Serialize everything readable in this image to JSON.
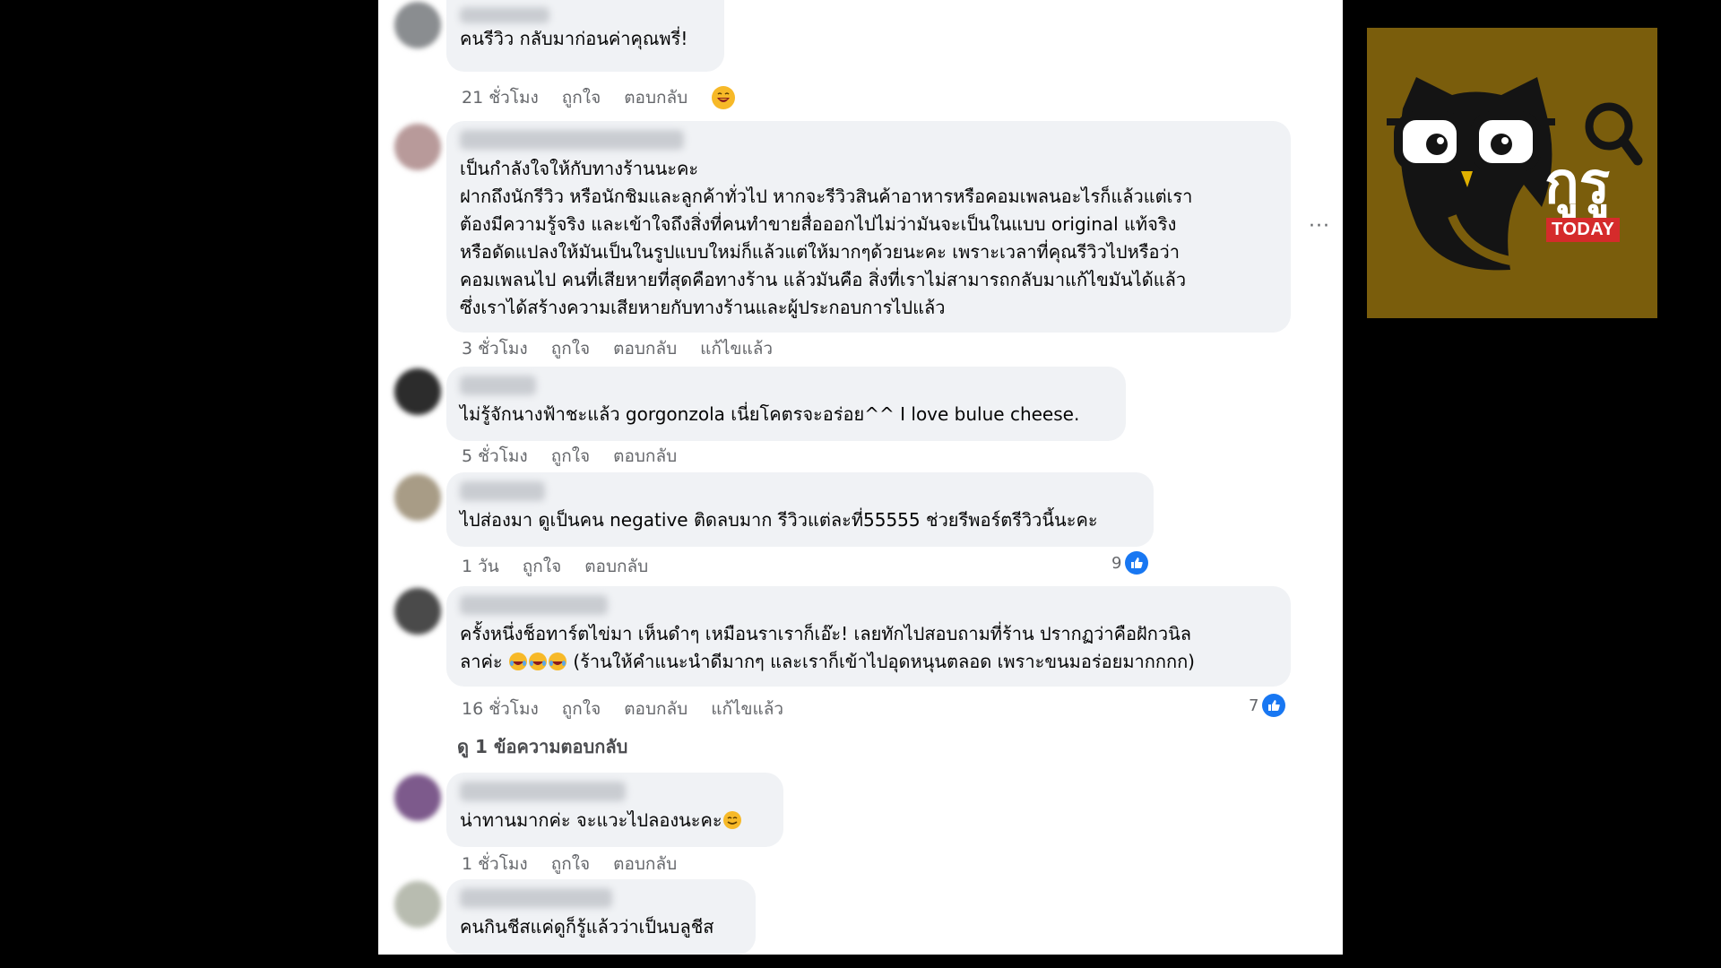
{
  "comments": [
    {
      "text": "คนรีวิว กลับมาก่อนค่าคุณพรี่!",
      "time": "21 ชั่วโมง",
      "like": "ถูกใจ",
      "reply": "ตอบกลับ"
    },
    {
      "text": "เป็นกำลังใจให้กับทางร้านนะคะ\nฝากถึงนักรีวิว หรือนักชิมและลูกค้าทั่วไป หากจะรีวิวสินค้าอาหารหรือคอมเพลนอะไรก็แล้วแต่เรา\nต้องมีความรู้จริง และเข้าใจถึงสิ่งที่คนทำขายสื่อออกไปไม่ว่ามันจะเป็นในแบบ original แท้จริง\nหรือดัดแปลงให้มันเป็นในรูปแบบใหม่ก็แล้วแต่ให้มากๆด้วยนะคะ เพราะเวลาที่คุณรีวิวไปหรือว่า\nคอมเพลนไป คนที่เสียหายที่สุดคือทางร้าน แล้วมันคือ สิ่งที่เราไม่สามารถกลับมาแก้ไขมันได้แล้ว\nซึ่งเราได้สร้างความเสียหายกับทางร้านและผู้ประกอบการไปแล้ว",
      "time": "3 ชั่วโมง",
      "like": "ถูกใจ",
      "reply": "ตอบกลับ",
      "edited": "แก้ไขแล้ว",
      "more": "···"
    },
    {
      "text": "ไม่รู้จักนางฟ้าชะแล้ว gorgonzola เนี่ยโคตรจะอร่อย^^ I love bulue cheese.",
      "time": "5 ชั่วโมง",
      "like": "ถูกใจ",
      "reply": "ตอบกลับ"
    },
    {
      "text": "ไปส่องมา ดูเป็นคน negative ติดลบมาก รีวิวแต่ละที่55555 ช่วยรีพอร์ตรีวิวนี้นะคะ",
      "time": "1 วัน",
      "like": "ถูกใจ",
      "reply": "ตอบกลับ",
      "like_count": "9"
    },
    {
      "text_line1": "ครั้งหนึ่งช็อทาร์ตไข่มา เห็นดำๆ เหมือนราเราก็เอ๊ะ! เลยทักไปสอบถามที่ร้าน ปรากฏว่าคือฝักวนิล",
      "text_line2_a": "ลาค่ะ ",
      "text_line2_b": " (ร้านให้คำแนะนำดีมากๆ และเราก็เข้าไปอุดหนุนตลอด เพราะขนมอร่อยมากกกก)",
      "time": "16 ชั่วโมง",
      "like": "ถูกใจ",
      "reply": "ตอบกลับ",
      "edited": "แก้ไขแล้ว",
      "like_count": "7",
      "view_replies": "ดู 1 ข้อความตอบกลับ"
    },
    {
      "text": "น่าทานมากค่ะ จะแวะไปลองนะคะ",
      "time": "1 ชั่วโมง",
      "like": "ถูกใจ",
      "reply": "ตอบกลับ"
    },
    {
      "text": "คนกินชีสแค่ดูก็รู้แล้วว่าเป็นบลูชีส"
    }
  ],
  "logo": {
    "word": "กูรู",
    "badge": "TODAY",
    "icon": "owl-with-glasses-icon"
  },
  "colors": {
    "bubble": "#f0f2f5",
    "meta_text": "#65676b",
    "like_blue": "#1877f2",
    "logo_bg": "#7a5d0c",
    "badge_red": "#d52b2b"
  }
}
